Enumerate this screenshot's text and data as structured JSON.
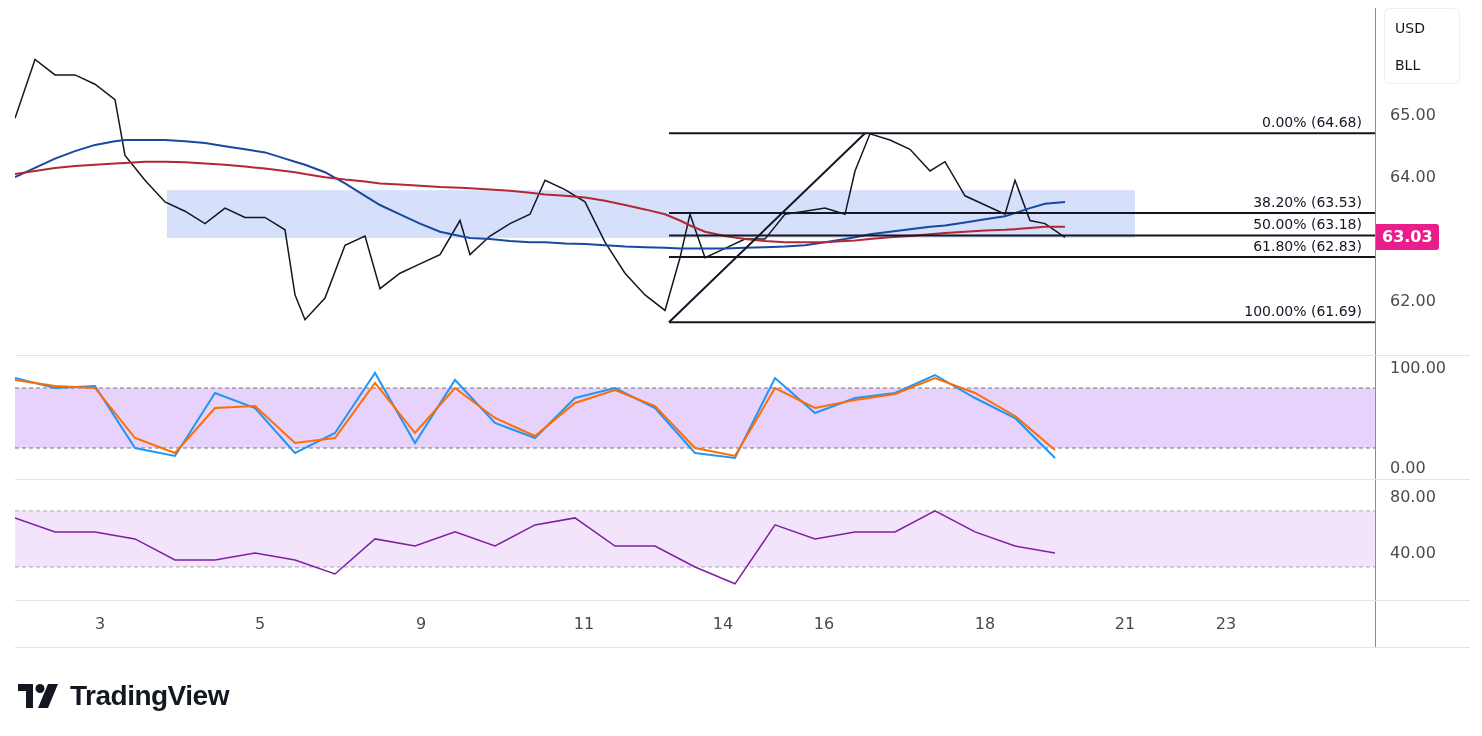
{
  "price_panel": {
    "scale_label": [
      "USD",
      "BLL"
    ],
    "last_price": "63.03",
    "y_axis_labels": [
      "65.00",
      "64.00",
      "62.00"
    ],
    "fibonacci_labels": [
      "0.00% (64.68)",
      "38.20% (63.53)",
      "50.00% (63.18)",
      "61.80% (62.83)",
      "100.00% (61.69)"
    ]
  },
  "stochastic_panel": {
    "y_axis_labels": [
      "100.00",
      "0.00"
    ]
  },
  "rsi_panel": {
    "y_axis_labels": [
      "80.00",
      "40.00"
    ]
  },
  "x_axis_labels": [
    "3",
    "5",
    "9",
    "11",
    "14",
    "16",
    "18",
    "21",
    "23"
  ],
  "logo": {
    "text": "TradingView"
  }
}
